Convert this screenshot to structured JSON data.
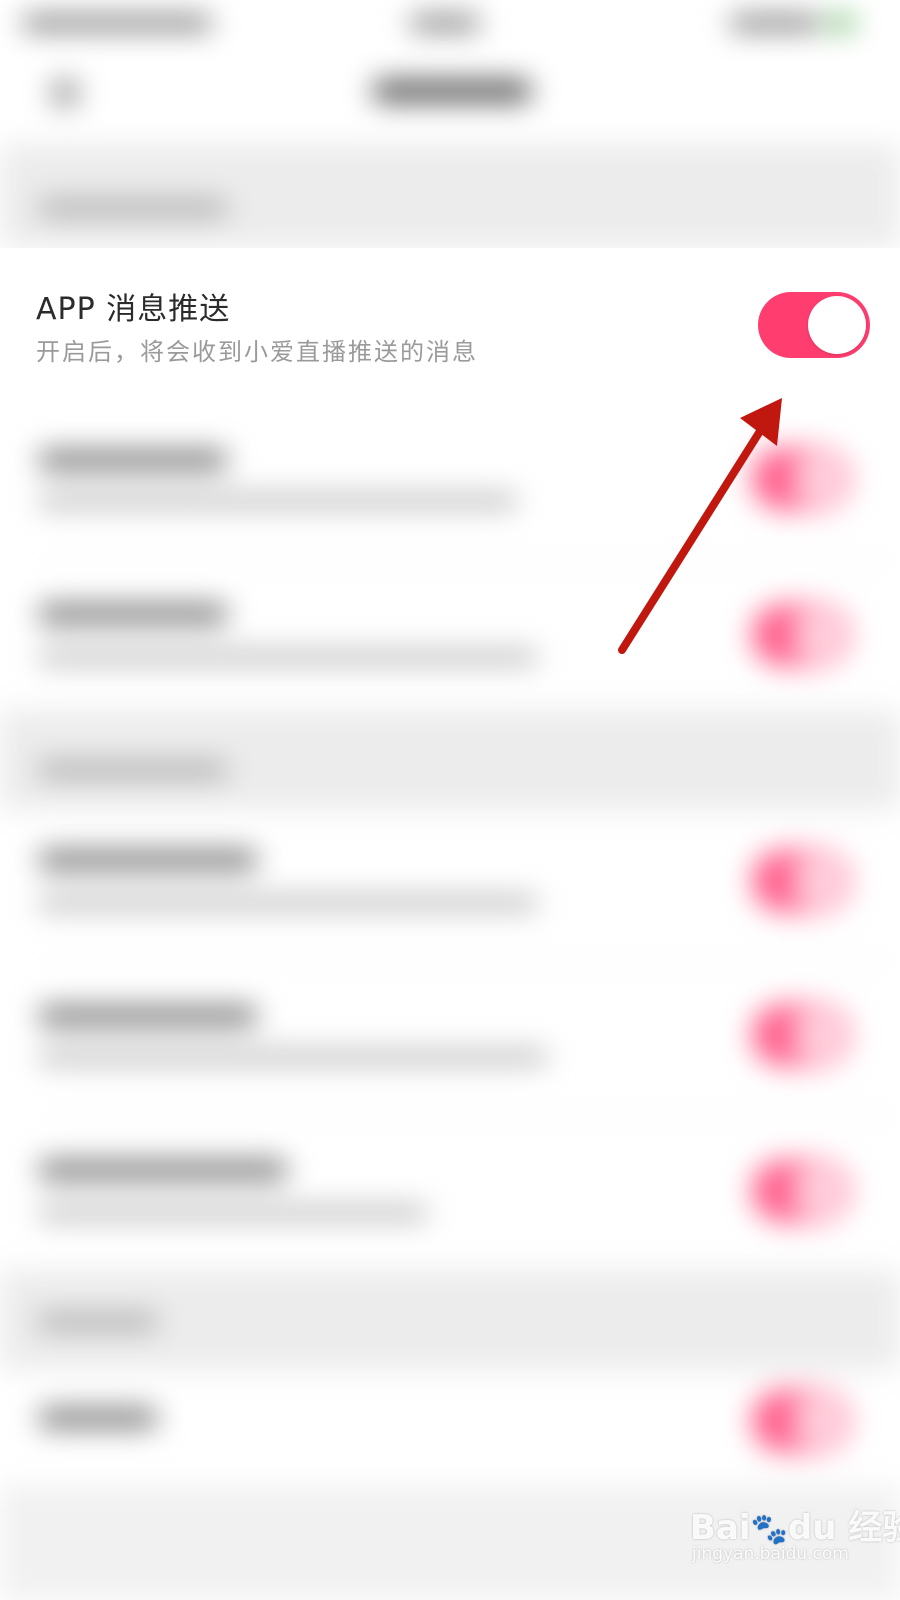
{
  "setting": {
    "title": "APP 消息推送",
    "description": "开启后，将会收到小爱直播推送的消息",
    "enabled": true
  },
  "colors": {
    "toggle_on": "#ff3d6f",
    "arrow": "#c0170f",
    "title_text": "#2b2b2b",
    "subtitle_text": "#9a9a9a"
  },
  "watermark": {
    "logo": "Bai du 经验",
    "url": "jingyan.baidu.com"
  }
}
